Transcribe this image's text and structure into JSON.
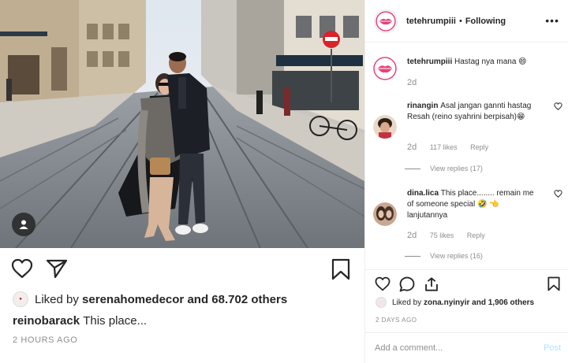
{
  "post": {
    "liked_prefix": "Liked by",
    "liked_user": "serenahomedecor",
    "liked_suffix": "and 68.702 others",
    "caption_user": "reinobarack",
    "caption_text": "This place...",
    "time": "2 HOURS AGO"
  },
  "panel": {
    "header": {
      "username": "tetehrumpiii",
      "separator": "•",
      "follow_status": "Following",
      "more": "•••"
    },
    "caption_comment": {
      "user": "tetehrumpiii",
      "text": "Hastag nya mana 😄",
      "age": "2d"
    },
    "comments": [
      {
        "user": "rinangin",
        "text": "Asal jangan gannti hastag Resah (reino syahrini berpisah)😁",
        "age": "2d",
        "likes": "117 likes",
        "reply": "Reply",
        "view_replies": "View replies (17)"
      },
      {
        "user": "dina.lica",
        "text": "This place........ remain me of someone special 🤣 👈 lanjutannya",
        "age": "2d",
        "likes": "75 likes",
        "reply": "Reply",
        "view_replies": "View replies (16)"
      }
    ],
    "liked_prefix": "Liked by",
    "liked_user": "zona.nyinyir",
    "liked_suffix": "and 1,906 others",
    "time": "2 DAYS AGO",
    "add_comment_placeholder": "Add a comment...",
    "post_button": "Post"
  },
  "colors": {
    "text": "#262626",
    "muted": "#8e8e8e",
    "post_disabled": "#b2dffc",
    "brand_pink": "#e8407a"
  },
  "icons": [
    "heart-icon",
    "comment-icon",
    "share-icon",
    "bookmark-icon",
    "user-tag-icon",
    "more-icon"
  ]
}
